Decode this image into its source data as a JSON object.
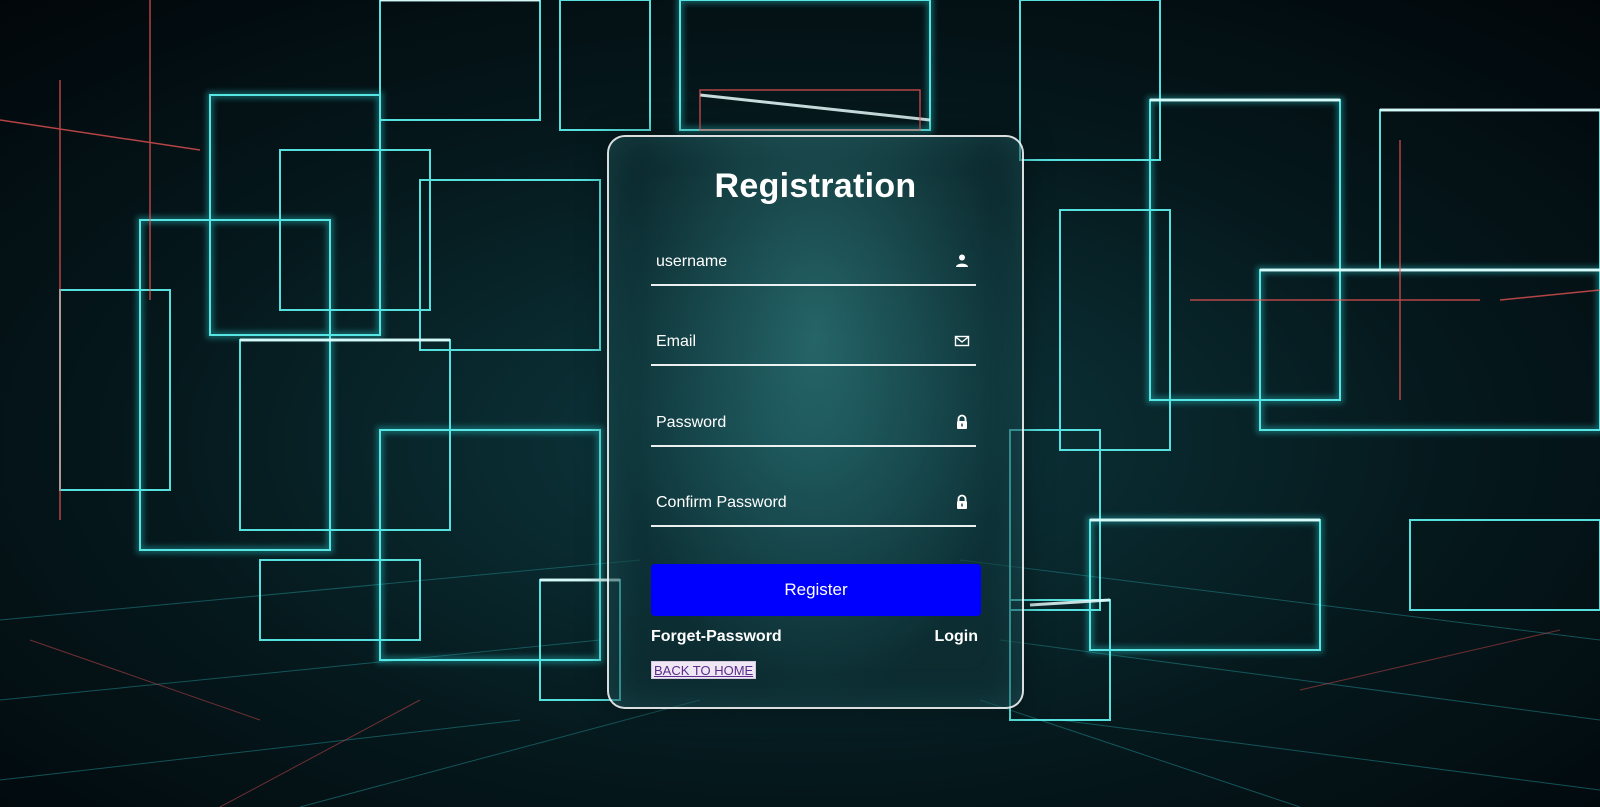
{
  "form": {
    "title": "Registration",
    "fields": [
      {
        "placeholder": "username",
        "value": "",
        "icon": "user-icon"
      },
      {
        "placeholder": "Email",
        "value": "",
        "icon": "envelope-icon"
      },
      {
        "placeholder": "Password",
        "value": "",
        "icon": "lock-icon"
      },
      {
        "placeholder": "Confirm Password",
        "value": "",
        "icon": "lock-icon"
      }
    ],
    "submit_label": "Register",
    "forgot_label": "Forget-Password",
    "login_label": "Login",
    "home_label": "BACK TO HOME"
  },
  "colors": {
    "button": "#0000ff",
    "glow": "#3ff3f0",
    "accent_red": "#ff5a5a",
    "text": "#ffffff"
  }
}
